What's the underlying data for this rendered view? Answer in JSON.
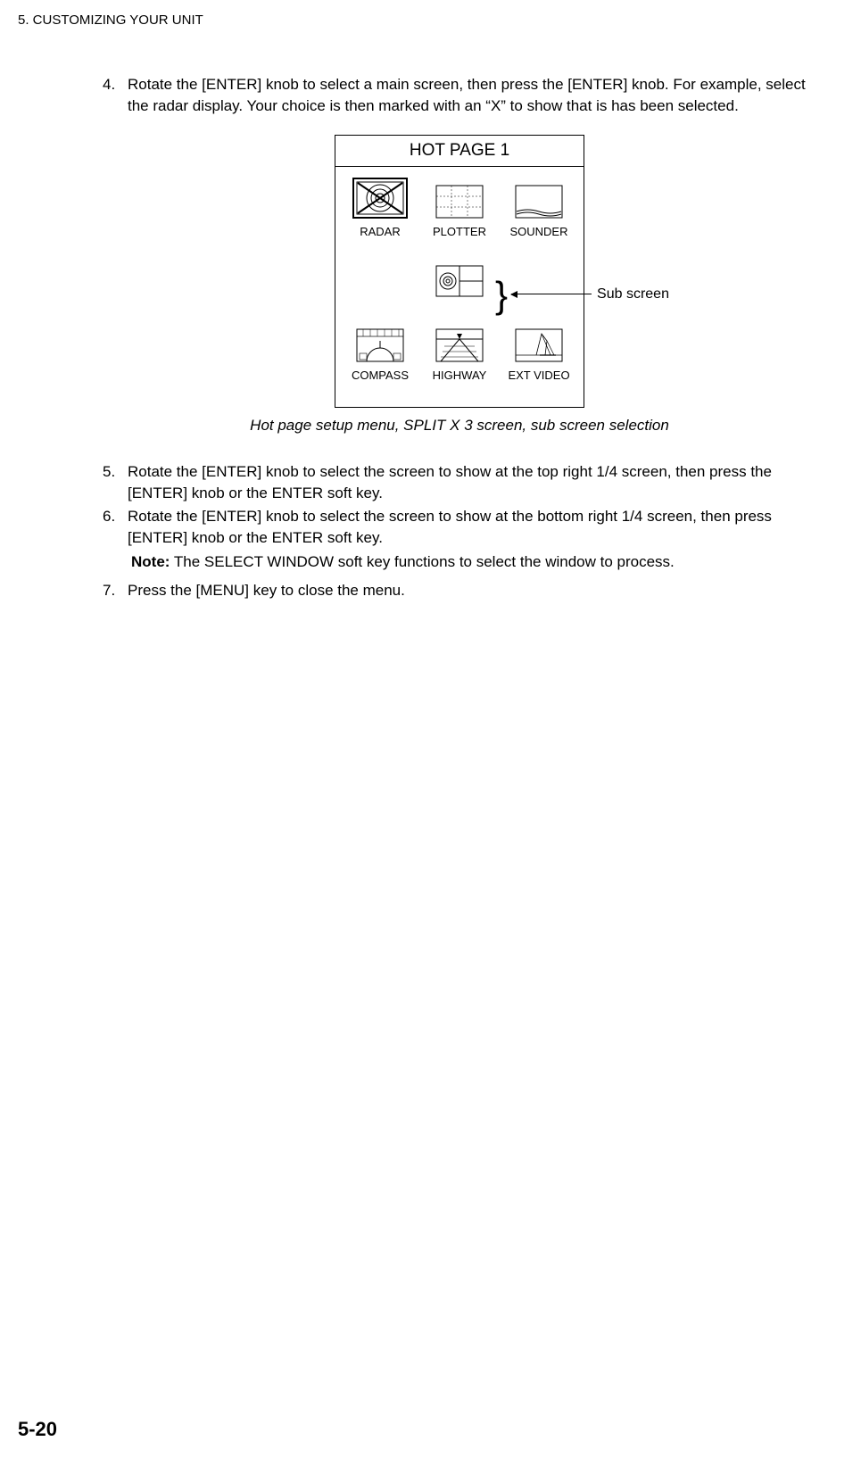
{
  "header": "5. CUSTOMIZING YOUR UNIT",
  "items": {
    "i4": {
      "num": "4.",
      "text": "Rotate the [ENTER] knob to select a main screen, then press the [ENTER] knob. For example, select the radar display. Your choice is then marked with an “X” to show that is has been selected."
    },
    "i5": {
      "num": "5.",
      "text": "Rotate the [ENTER] knob to select the screen to show at the top right 1/4 screen, then press the [ENTER] knob or the ENTER soft key."
    },
    "i6": {
      "num": "6.",
      "text": "Rotate the [ENTER] knob to select the screen to show at the bottom right 1/4 screen, then press [ENTER] knob or the ENTER soft key."
    },
    "note": {
      "label": "Note:",
      "text": " The SELECT WINDOW soft key functions to select the window to process."
    },
    "i7": {
      "num": "7.",
      "text": "Press the [MENU] key to close the menu."
    }
  },
  "figure": {
    "title": "HOT PAGE 1",
    "row1": {
      "a": "RADAR",
      "b": "PLOTTER",
      "c": "SOUNDER"
    },
    "row3": {
      "a": "COMPASS",
      "b": "HIGHWAY",
      "c": "EXT VIDEO"
    },
    "annotation": "Sub screen",
    "caption": "Hot page setup menu, SPLIT X 3 screen, sub screen selection"
  },
  "pageNumber": "5-20"
}
